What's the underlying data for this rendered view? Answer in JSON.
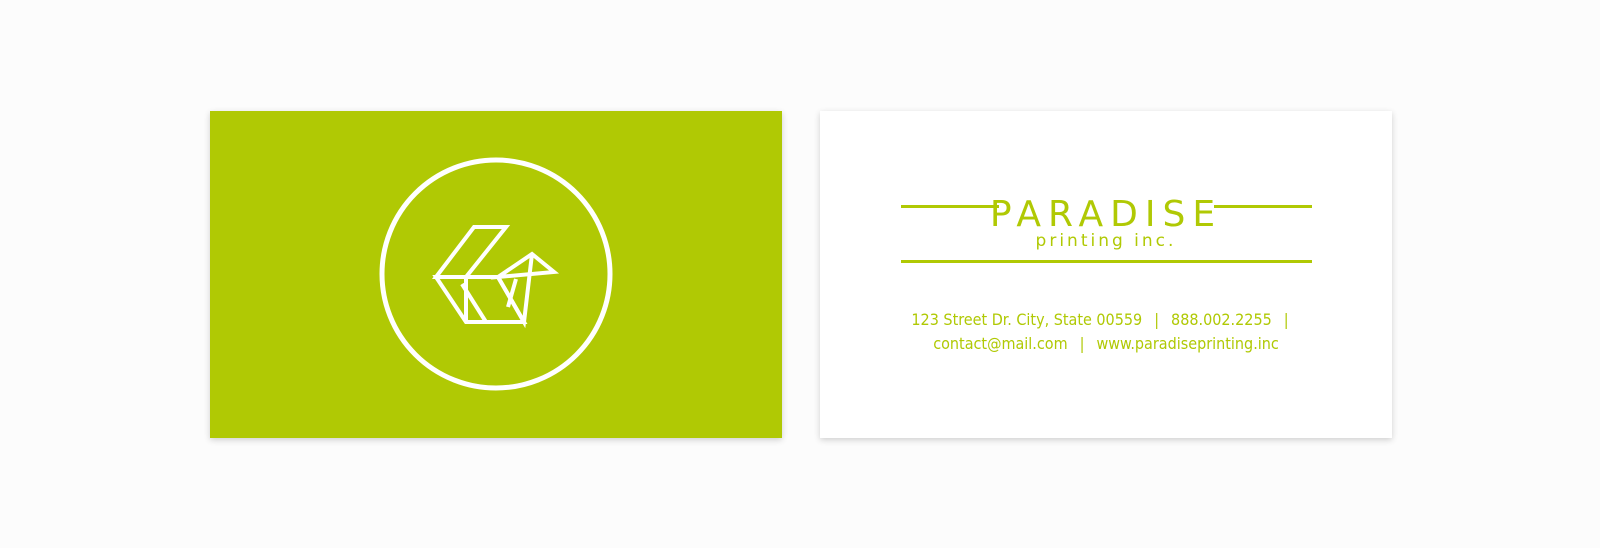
{
  "colors": {
    "brand": "#b0c904",
    "white": "#ffffff"
  },
  "front": {
    "logo_icon": "origami-bird-icon"
  },
  "back": {
    "brand_name": "PARADISE",
    "brand_sub": "printing inc.",
    "address": "123 Street Dr. City, State  00559",
    "phone": "888.002.2255",
    "email": "contact@mail.com",
    "website": "www.paradiseprinting.inc",
    "separator": "|"
  }
}
